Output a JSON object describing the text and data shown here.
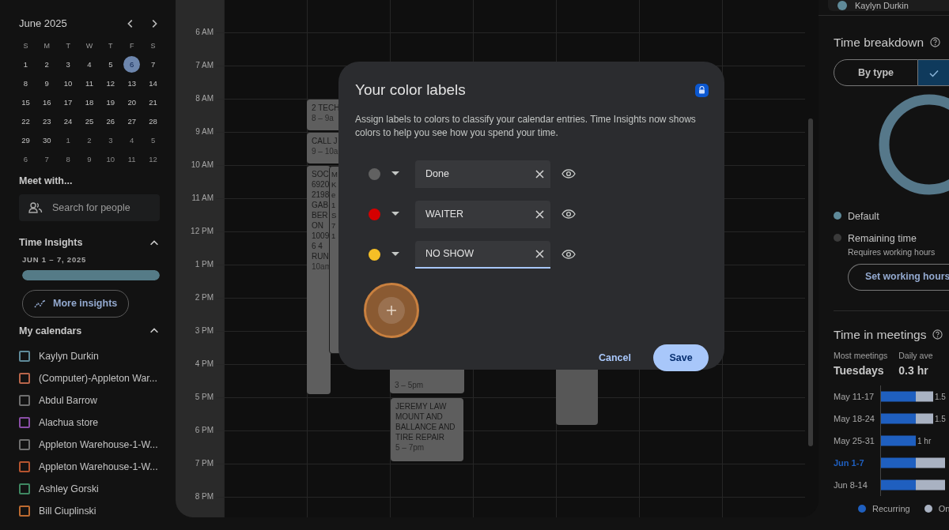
{
  "mini_calendar": {
    "title": "June 2025",
    "weekdays": [
      "S",
      "M",
      "T",
      "W",
      "T",
      "F",
      "S"
    ],
    "weeks": [
      [
        {
          "label": "1",
          "muted": false,
          "selected": false
        },
        {
          "label": "2",
          "muted": false,
          "selected": false
        },
        {
          "label": "3",
          "muted": false,
          "selected": false
        },
        {
          "label": "4",
          "muted": false,
          "selected": false
        },
        {
          "label": "5",
          "muted": false,
          "selected": false
        },
        {
          "label": "6",
          "muted": false,
          "selected": true
        },
        {
          "label": "7",
          "muted": false,
          "selected": false
        }
      ],
      [
        {
          "label": "8",
          "muted": false,
          "selected": false
        },
        {
          "label": "9",
          "muted": false,
          "selected": false
        },
        {
          "label": "10",
          "muted": false,
          "selected": false
        },
        {
          "label": "11",
          "muted": false,
          "selected": false
        },
        {
          "label": "12",
          "muted": false,
          "selected": false
        },
        {
          "label": "13",
          "muted": false,
          "selected": false
        },
        {
          "label": "14",
          "muted": false,
          "selected": false
        }
      ],
      [
        {
          "label": "15",
          "muted": false,
          "selected": false
        },
        {
          "label": "16",
          "muted": false,
          "selected": false
        },
        {
          "label": "17",
          "muted": false,
          "selected": false
        },
        {
          "label": "18",
          "muted": false,
          "selected": false
        },
        {
          "label": "19",
          "muted": false,
          "selected": false
        },
        {
          "label": "20",
          "muted": false,
          "selected": false
        },
        {
          "label": "21",
          "muted": false,
          "selected": false
        }
      ],
      [
        {
          "label": "22",
          "muted": false,
          "selected": false
        },
        {
          "label": "23",
          "muted": false,
          "selected": false
        },
        {
          "label": "24",
          "muted": false,
          "selected": false
        },
        {
          "label": "25",
          "muted": false,
          "selected": false
        },
        {
          "label": "26",
          "muted": false,
          "selected": false
        },
        {
          "label": "27",
          "muted": false,
          "selected": false
        },
        {
          "label": "28",
          "muted": false,
          "selected": false
        }
      ],
      [
        {
          "label": "29",
          "muted": false,
          "selected": false
        },
        {
          "label": "30",
          "muted": false,
          "selected": false
        },
        {
          "label": "1",
          "muted": true,
          "selected": false
        },
        {
          "label": "2",
          "muted": true,
          "selected": false
        },
        {
          "label": "3",
          "muted": true,
          "selected": false
        },
        {
          "label": "4",
          "muted": true,
          "selected": false
        },
        {
          "label": "5",
          "muted": true,
          "selected": false
        }
      ],
      [
        {
          "label": "6",
          "muted": true,
          "selected": false
        },
        {
          "label": "7",
          "muted": true,
          "selected": false
        },
        {
          "label": "8",
          "muted": true,
          "selected": false
        },
        {
          "label": "9",
          "muted": true,
          "selected": false
        },
        {
          "label": "10",
          "muted": true,
          "selected": false
        },
        {
          "label": "11",
          "muted": true,
          "selected": false
        },
        {
          "label": "12",
          "muted": true,
          "selected": false
        }
      ]
    ]
  },
  "meet_with": {
    "heading": "Meet with...",
    "placeholder": "Search for people"
  },
  "time_insights": {
    "heading": "Time Insights",
    "expanded": true,
    "range": "JUN 1 – 7, 2025",
    "level": 1,
    "button": "More insights"
  },
  "my_calendars": {
    "heading": "My calendars",
    "expanded": true,
    "items": [
      {
        "name": "Kaylyn Durkin",
        "color": "#5f8a99",
        "checked": false
      },
      {
        "name": "(Computer)-Appleton War...",
        "color": "#b8654a",
        "checked": false
      },
      {
        "name": "Abdul Barrow",
        "color": "#6f6f6f",
        "checked": false
      },
      {
        "name": "Alachua store",
        "color": "#8a4ea6",
        "checked": false
      },
      {
        "name": "Appleton Warehouse-1-W...",
        "color": "#6f6f6f",
        "checked": false
      },
      {
        "name": "Appleton Warehouse-1-W...",
        "color": "#b5542f",
        "checked": false
      },
      {
        "name": "Ashley Gorski",
        "color": "#3f8862",
        "checked": false
      },
      {
        "name": "Bill Ciuplinski",
        "color": "#bb6a30",
        "checked": false
      }
    ]
  },
  "calendar": {
    "hours": [
      "6 AM",
      "7 AM",
      "8 AM",
      "9 AM",
      "10 AM",
      "11 AM",
      "12 PM",
      "1 PM",
      "2 PM",
      "3 PM",
      "4 PM",
      "5 PM",
      "6 PM",
      "7 PM",
      "8 PM"
    ],
    "events": [
      {
        "lines": [
          "2 TECH"
        ],
        "time": "8 – 9a"
      },
      {
        "lines": [
          "CALL J"
        ],
        "time": "9 – 10a"
      },
      {
        "lines": [
          "SOC",
          "6920",
          "2198",
          "GAB",
          "BER",
          "ON",
          "1009",
          "6 4",
          "RUN"
        ],
        "time": "10am"
      },
      {
        "lines": [
          "M",
          "K",
          "e",
          "1",
          "S",
          "7",
          "1"
        ]
      },
      {
        "time": "3 – 5pm"
      },
      {
        "lines": [
          "JEREMY LAW",
          "MOUNT AND",
          "BALLANCE AND",
          "TIRE REPAIR"
        ],
        "time": "5 – 7pm"
      },
      {
        "blank": true
      }
    ]
  },
  "dialog": {
    "title": "Your color labels",
    "locked": true,
    "description": "Assign labels to colors to classify your calendar entries. Time Insights now shows colors to help you see how you spend your time.",
    "labels": [
      {
        "color": "#616161",
        "value": "Done",
        "focused": false,
        "visible": true
      },
      {
        "color": "#d50000",
        "value": "WAITER",
        "focused": false,
        "visible": true
      },
      {
        "color": "#f6bf26",
        "value": "NO SHOW",
        "focused": true,
        "visible": true
      }
    ],
    "add_highlighted": true,
    "cancel": "Cancel",
    "save": "Save"
  },
  "right_panel": {
    "person": {
      "name": "Kaylyn Durkin",
      "color": "#5f8a99"
    },
    "breakdown": {
      "heading": "Time breakdown",
      "tabs": [
        {
          "label": "By type",
          "selected": false
        },
        {
          "selected": true
        }
      ],
      "legend": [
        {
          "label": "Default",
          "color": "#5f8a99"
        },
        {
          "label": "Remaining time",
          "color": "#3a3a3a",
          "note": "Requires working hours"
        }
      ],
      "button": "Set working hours"
    },
    "meetings": {
      "heading": "Time in meetings",
      "stats": [
        {
          "label": "Most meetings",
          "value": "Tuesdays"
        },
        {
          "label": "Daily ave",
          "value": "0.3 hr"
        }
      ],
      "rows": [
        {
          "label": "May 11-17",
          "highlighted": false,
          "value": "1.5"
        },
        {
          "label": "May 18-24",
          "highlighted": false,
          "value": "1.5"
        },
        {
          "label": "May 25-31",
          "highlighted": false,
          "value": "1 hr"
        },
        {
          "label": "Jun 1-7",
          "highlighted": true
        },
        {
          "label": "Jun 8-14",
          "highlighted": false
        }
      ],
      "legend": [
        {
          "name": "Recurring",
          "color": "#1f5fbf"
        },
        {
          "name": "On",
          "color": "#a9b2c2"
        }
      ]
    }
  }
}
